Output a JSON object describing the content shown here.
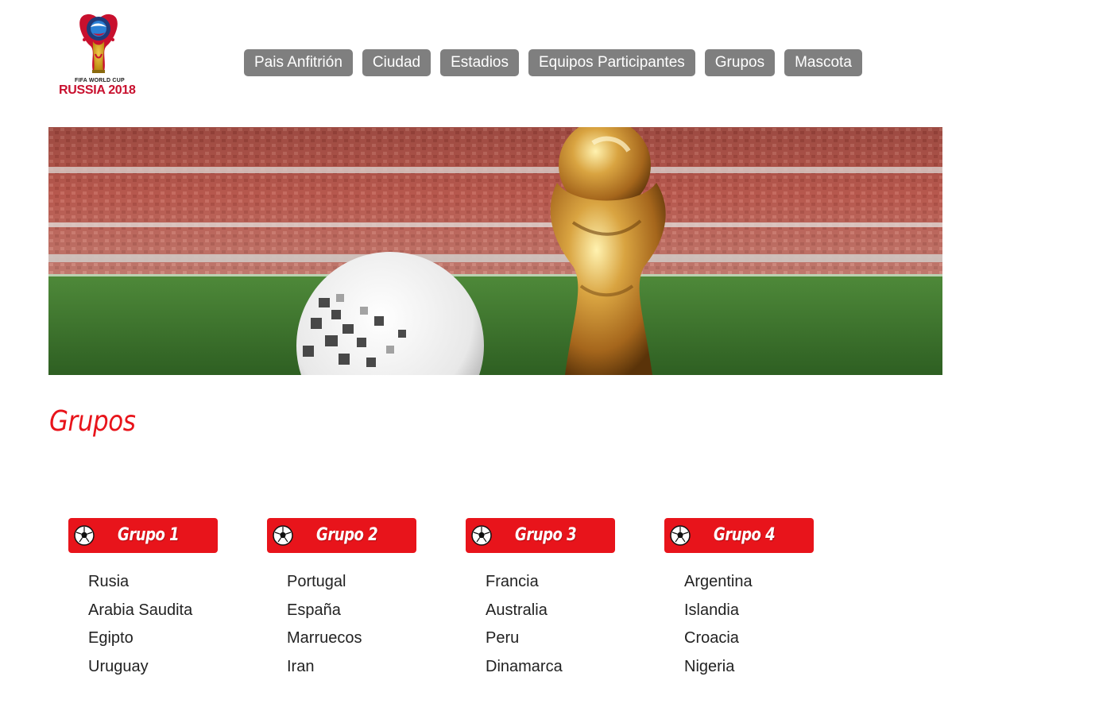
{
  "logo": {
    "line1": "FIFA WORLD CUP",
    "line2": "RUSSIA 2018"
  },
  "nav": [
    {
      "label": "Pais Anfitrión"
    },
    {
      "label": "Ciudad"
    },
    {
      "label": "Estadios"
    },
    {
      "label": "Equipos Participantes"
    },
    {
      "label": "Grupos"
    },
    {
      "label": "Mascota"
    }
  ],
  "banner": {
    "icon": "stadium-ball-trophy-image"
  },
  "section": {
    "title": "Grupos"
  },
  "groups": [
    {
      "title": "Grupo 1",
      "teams": [
        "Rusia",
        "Arabia Saudita",
        "Egipto",
        "Uruguay"
      ]
    },
    {
      "title": "Grupo 2",
      "teams": [
        "Portugal",
        "España",
        "Marruecos",
        "Iran"
      ]
    },
    {
      "title": "Grupo 3",
      "teams": [
        "Francia",
        "Australia",
        "Peru",
        "Dinamarca"
      ]
    },
    {
      "title": "Grupo 4",
      "teams": [
        "Argentina",
        "Islandia",
        "Croacia",
        "Nigeria"
      ]
    }
  ],
  "colors": {
    "accent": "#e8141b",
    "nav_bg": "#7f7f7f"
  }
}
